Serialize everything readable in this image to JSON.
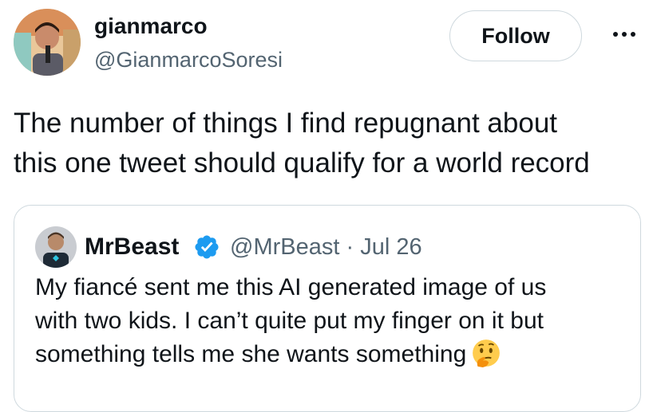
{
  "author": {
    "display_name": "gianmarco",
    "handle": "@GianmarcoSoresi",
    "avatar_icon": "user-photo-avatar"
  },
  "actions": {
    "follow_label": "Follow",
    "more_icon": "more-dots-icon"
  },
  "tweet": {
    "text_line1": "The number of things I find repugnant about",
    "text_line2": "this one tweet should qualify for a world record"
  },
  "quoted_tweet": {
    "display_name": "MrBeast",
    "verified": true,
    "verified_color": "#1d9bf0",
    "handle": "@MrBeast",
    "separator": "·",
    "date": "Jul 26",
    "text_line1": "My fiancé sent me this AI generated image of us",
    "text_line2": "with two kids. I can’t quite put my finger on it but",
    "text_line3": "something tells me she wants something",
    "emoji_icon": "thinking-face-icon"
  }
}
